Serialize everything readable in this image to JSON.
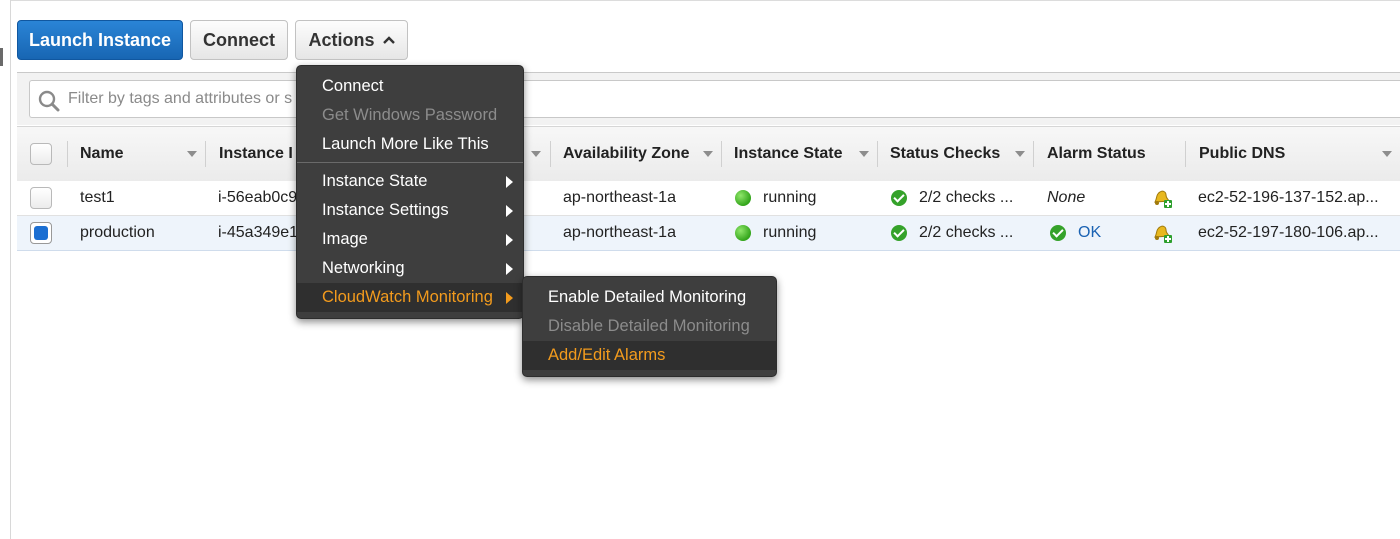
{
  "toolbar": {
    "launch_label": "Launch Instance",
    "connect_label": "Connect",
    "actions_label": "Actions"
  },
  "search": {
    "placeholder": "Filter by tags and attributes or s"
  },
  "table": {
    "columns": [
      "Name",
      "Instance I",
      "Availability Zone",
      "Instance State",
      "Status Checks",
      "Alarm Status",
      "Public DNS"
    ],
    "rows": [
      {
        "name": "test1",
        "instance_id": "i-56eab0c9",
        "zone": "ap-northeast-1a",
        "state": "running",
        "status_checks": "2/2 checks ...",
        "alarm": "None",
        "dns": "ec2-52-196-137-152.ap...",
        "selected": false
      },
      {
        "name": "production",
        "instance_id": "i-45a349e1",
        "zone": "ap-northeast-1a",
        "state": "running",
        "status_checks": "2/2 checks ...",
        "alarm": "OK",
        "dns": "ec2-52-197-180-106.ap...",
        "selected": true
      }
    ]
  },
  "actions_menu": {
    "items": [
      {
        "label": "Connect"
      },
      {
        "label": "Get Windows Password"
      },
      {
        "label": "Launch More Like This"
      },
      {
        "label": "Instance State"
      },
      {
        "label": "Instance Settings"
      },
      {
        "label": "Image"
      },
      {
        "label": "Networking"
      },
      {
        "label": "CloudWatch Monitoring"
      }
    ]
  },
  "cloudwatch_submenu": {
    "items": [
      {
        "label": "Enable Detailed Monitoring"
      },
      {
        "label": "Disable Detailed Monitoring"
      },
      {
        "label": "Add/Edit Alarms"
      }
    ]
  },
  "colors": {
    "primary_button": "#1866b3",
    "menu_background": "#3e3e3e",
    "menu_highlight": "#f39b1d",
    "status_green": "#35a22a",
    "ok_link": "#1a62b3"
  }
}
